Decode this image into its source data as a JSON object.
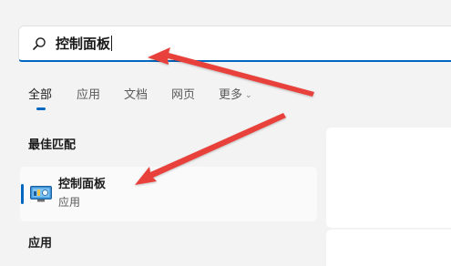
{
  "search": {
    "query": "控制面板",
    "icon": "search-icon"
  },
  "tabs": [
    {
      "label": "全部",
      "active": true
    },
    {
      "label": "应用",
      "active": false
    },
    {
      "label": "文档",
      "active": false
    },
    {
      "label": "网页",
      "active": false
    },
    {
      "label": "更多",
      "active": false,
      "icon": "chevron-down-icon"
    }
  ],
  "best_match": {
    "heading": "最佳匹配",
    "result": {
      "title": "控制面板",
      "subtitle": "应用",
      "icon": "control-panel-icon"
    }
  },
  "apps_section": {
    "heading": "应用"
  },
  "colors": {
    "accent": "#0067c0",
    "annotation_arrow": "#e8403a",
    "background": "#f3f3f3"
  }
}
